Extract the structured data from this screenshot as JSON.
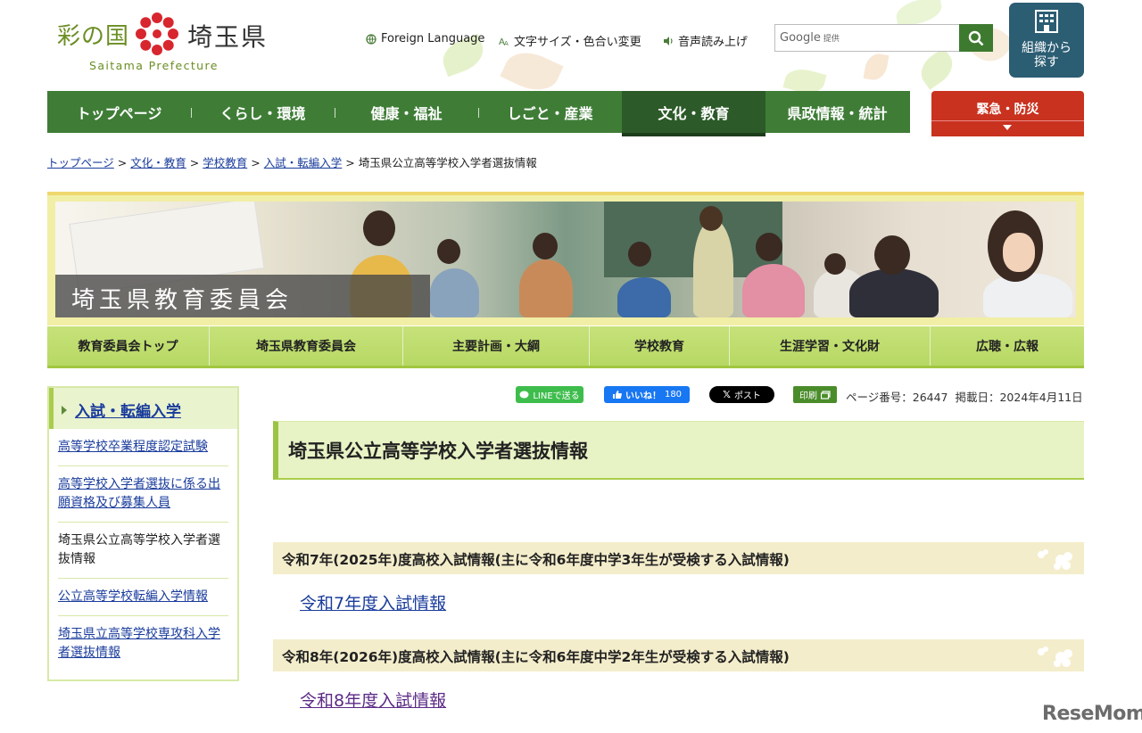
{
  "header": {
    "logo_jp_left": "彩の国",
    "logo_jp_right": "埼玉県",
    "logo_en": "Saitama Prefecture",
    "util_links": {
      "foreign": "Foreign Language",
      "text_size": "文字サイズ・色合い変更",
      "voice": "音声読み上げ"
    },
    "search": {
      "brand": "Google",
      "brand_sub": "提供"
    },
    "org_button": {
      "line1": "組織から",
      "line2": "探す"
    }
  },
  "gnav": {
    "items": [
      "トップページ",
      "くらし・環境",
      "健康・福祉",
      "しごと・産業",
      "文化・教育",
      "県政情報・統計"
    ],
    "active": "文化・教育",
    "emergency": "緊急・防災"
  },
  "breadcrumb": {
    "items": [
      "トップページ",
      "文化・教育",
      "学校教育",
      "入試・転編入学"
    ],
    "current": "埼玉県公立高等学校入学者選抜情報",
    "separator": ">"
  },
  "banner": {
    "caption": "埼玉県教育委員会"
  },
  "subnav": {
    "items": [
      "教育委員会トップ",
      "埼玉県教育委員会",
      "主要計画・大綱",
      "学校教育",
      "生涯学習・文化財",
      "広聴・広報"
    ]
  },
  "side_menu": {
    "title": "入試・転編入学",
    "items": [
      "高等学校卒業程度認定試験",
      "高等学校入学者選抜に係る出願資格及び募集人員",
      "埼玉県公立高等学校入学者選抜情報",
      "公立高等学校転編入学情報",
      "埼玉県立高等学校専攻科入学者選抜情報"
    ]
  },
  "share": {
    "line": "LINEで送る",
    "fb_like": "いいね！",
    "fb_count": "180",
    "x_post": "ポスト",
    "print": "印刷"
  },
  "page_info": {
    "page_number": "ページ番号：26447",
    "posted": "掲載日：2024年4月11日"
  },
  "main": {
    "title": "埼玉県公立高等学校入学者選抜情報",
    "sections": [
      {
        "heading": "令和7年(2025年)度高校入試情報(主に令和6年度中学3年生が受検する入試情報)",
        "link": "令和7年度入試情報"
      },
      {
        "heading": "令和8年(2026年)度高校入試情報(主に令和6年度中学2年生が受検する入試情報)",
        "link": "令和8年度入試情報"
      }
    ]
  },
  "watermark": "ReseMom",
  "colors": {
    "gnav": "#3f7d37",
    "gnav_active": "#2c5a28",
    "emergency": "#c8321f",
    "subnav": "#b7d864",
    "title_bg": "#e8f3c5",
    "section_bg": "#f4edcb",
    "org_button": "#2b5d73"
  }
}
